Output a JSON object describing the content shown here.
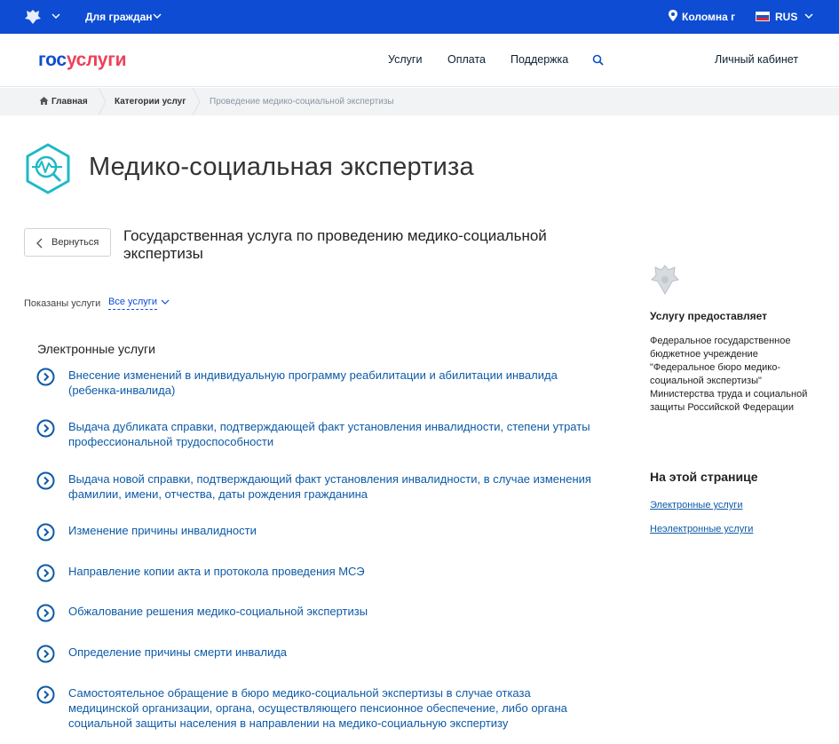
{
  "topbar": {
    "audience": "Для граждан",
    "location": "Коломна г",
    "language": "RUS"
  },
  "header": {
    "logo_part1": "гос",
    "logo_part2": "услуги",
    "nav": [
      "Услуги",
      "Оплата",
      "Поддержка"
    ],
    "cabinet": "Личный кабинет"
  },
  "breadcrumb": [
    "Главная",
    "Категории услуг",
    "Проведение медико-социальной экспертизы"
  ],
  "page": {
    "title": "Медико-социальная экспертиза",
    "back_label": "Вернуться",
    "service_title": "Государственная услуга по проведению медико-социальной экспертизы",
    "shown_label": "Показаны услуги",
    "filter_value": "Все услуги",
    "section_title": "Электронные услуги",
    "services": [
      "Внесение изменений в индивидуальную программу реабилитации и абилитации инвалида (ребенка-инвалида)",
      "Выдача дубликата справки, подтверждающей факт установления инвалидности, степени утраты профессиональной трудоспособности",
      "Выдача новой справки, подтверждающий факт установления инвалидности, в случае изменения фамилии, имени, отчества, даты рождения гражданина",
      "Изменение причины инвалидности",
      "Направление копии акта и протокола проведения МСЭ",
      "Обжалование решения медико-социальной экспертизы",
      "Определение причины смерти инвалида",
      "Самостоятельное обращение в бюро медико-социальной экспертизы в случае отказа медицинской организации, органа, осуществляющего пенсионное обеспечение, либо органа социальной защиты населения в направлении на медико-социальную экспертизу"
    ]
  },
  "sidebar": {
    "provider_title": "Услугу предоставляет",
    "provider_text": "Федеральное государственное бюджетное учреждение \"Федеральное бюро медико-социальной экспертизы\" Министерства труда и социальной защиты Российской Федерации",
    "onpage_title": "На этой странице",
    "anchors": [
      "Электронные услуги",
      "Неэлектронные услуги"
    ]
  },
  "colors": {
    "brand_blue": "#0d4cd3",
    "brand_red": "#ee3f58",
    "link": "#0d5aa7",
    "teal": "#1fb9c8"
  },
  "icons": [
    "emblem-icon",
    "chevron-down-icon",
    "location-pin-icon",
    "flag-icon",
    "search-icon",
    "home-icon",
    "pulse-search-icon",
    "chevron-left-icon",
    "circle-chevron-right-icon"
  ]
}
